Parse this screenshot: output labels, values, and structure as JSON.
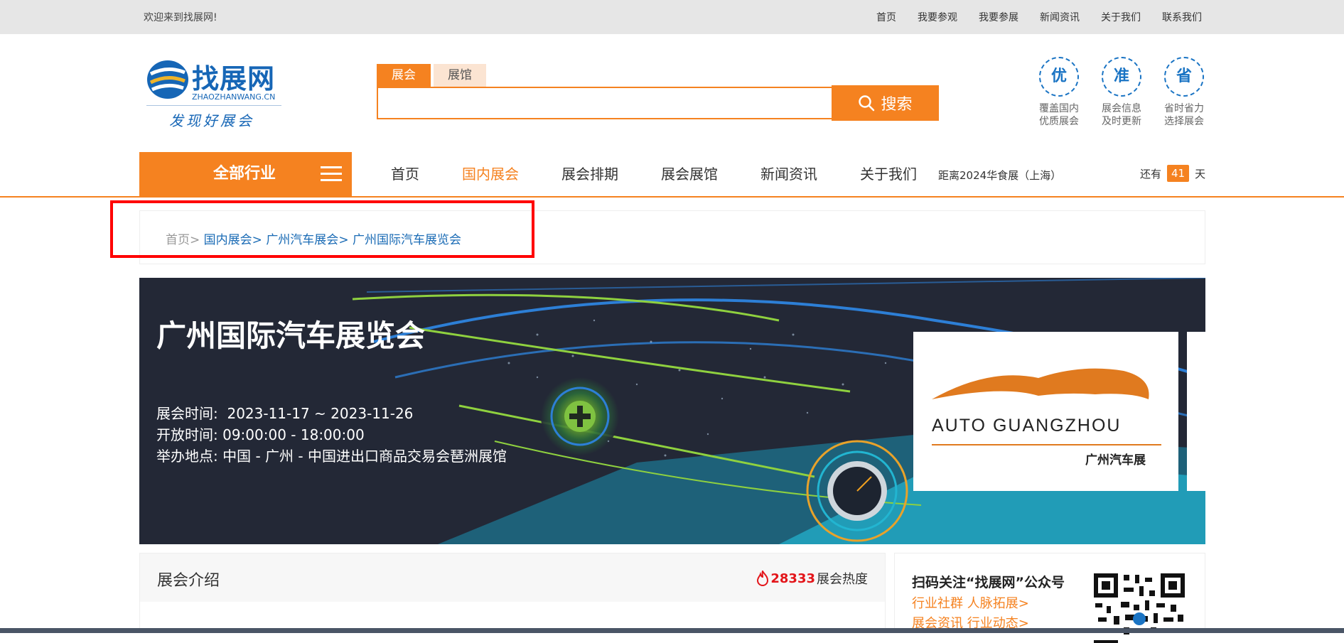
{
  "topbar": {
    "welcome": "欢迎来到找展网!",
    "links": [
      "首页",
      "我要参观",
      "我要参展",
      "新闻资讯",
      "关于我们",
      "联系我们"
    ]
  },
  "logo": {
    "brand": "找展网",
    "domain": "ZHAOZHANWANG.CN",
    "slogan": "发现好展会"
  },
  "search": {
    "tabs": [
      "展会",
      "展馆"
    ],
    "active_tab": "展会",
    "placeholder": "",
    "button_label": "搜索"
  },
  "features": [
    {
      "icon": "优",
      "line1": "覆盖国内",
      "line2": "优质展会"
    },
    {
      "icon": "准",
      "line1": "展会信息",
      "line2": "及时更新"
    },
    {
      "icon": "省",
      "line1": "省时省力",
      "line2": "选择展会"
    }
  ],
  "nav": {
    "all_label": "全部行业",
    "items": [
      "首页",
      "国内展会",
      "展会排期",
      "展会展馆",
      "新闻资讯",
      "关于我们"
    ],
    "active_item": "国内展会",
    "countdown_title": "距离2024华食展（上海）",
    "countdown_prefix": "还有",
    "countdown_days": "41",
    "countdown_suffix": "天"
  },
  "breadcrumb": {
    "home": "首页",
    "items": [
      "国内展会",
      "广州汽车展会",
      "广州国际汽车展览会"
    ]
  },
  "banner": {
    "title": "广州国际汽车展览会",
    "time_label": "展会时间:",
    "time_value": "2023-11-17 ~ 2023-11-26",
    "open_label": "开放时间:",
    "open_value": "09:00:00 - 18:00:00",
    "place_label": "举办地点:",
    "place_value": "中国 - 广州 - 中国进出口商品交易会琶洲展馆",
    "exhibit_logo_name": "AUTO GUANGZHOU",
    "exhibit_logo_sub": "广州汽车展"
  },
  "intro": {
    "title": "展会介绍",
    "heat_value": "28333",
    "heat_label": "展会热度"
  },
  "qr": {
    "title": "扫码关注“找展网”公众号",
    "line1": "行业社群 人脉拓展>",
    "line2": "展会资讯 行业动态>"
  },
  "colors": {
    "accent": "#f58220",
    "brand_blue": "#1666b6",
    "link_blue": "#1a6bb5",
    "heat_red": "#e3151a",
    "highlight_red": "#ff0000"
  }
}
